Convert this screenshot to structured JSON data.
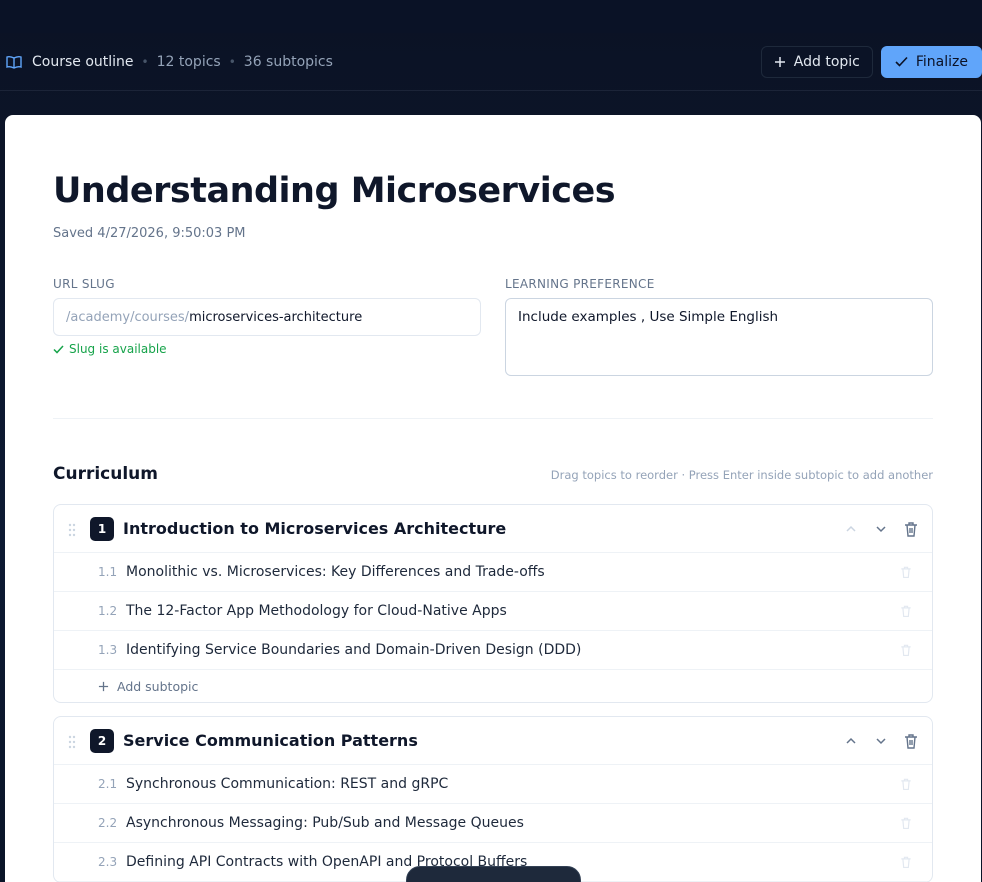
{
  "header": {
    "title": "Course outline",
    "topics": "12 topics",
    "subtopics": "36 subtopics",
    "add_topic": "Add topic",
    "finalize": "Finalize"
  },
  "course": {
    "title": "Understanding Microservices",
    "saved": "Saved 4/27/2026, 9:50:03 PM",
    "slug_label": "URL SLUG",
    "slug_prefix": "/academy/courses/",
    "slug_value": "microservices-architecture",
    "slug_status": "Slug is available",
    "pref_label": "LEARNING PREFERENCE",
    "pref_value": "Include examples , Use Simple English"
  },
  "curriculum": {
    "title": "Curriculum",
    "hint": "Drag topics to reorder · Press Enter inside subtopic to add another",
    "add_subtopic": "Add subtopic",
    "topics": [
      {
        "num": "1",
        "title": "Introduction to Microservices Architecture",
        "subtopics": [
          {
            "num": "1.1",
            "title": "Monolithic vs. Microservices: Key Differences and Trade-offs"
          },
          {
            "num": "1.2",
            "title": "The 12-Factor App Methodology for Cloud-Native Apps"
          },
          {
            "num": "1.3",
            "title": "Identifying Service Boundaries and Domain-Driven Design (DDD)"
          }
        ]
      },
      {
        "num": "2",
        "title": "Service Communication Patterns",
        "subtopics": [
          {
            "num": "2.1",
            "title": "Synchronous Communication: REST and gRPC"
          },
          {
            "num": "2.2",
            "title": "Asynchronous Messaging: Pub/Sub and Message Queues"
          },
          {
            "num": "2.3",
            "title": "Defining API Contracts with OpenAPI and Protocol Buffers"
          }
        ]
      }
    ]
  },
  "colors": {
    "primary": "#60a5fa",
    "success": "#16a34a",
    "dark": "#0f172a"
  }
}
